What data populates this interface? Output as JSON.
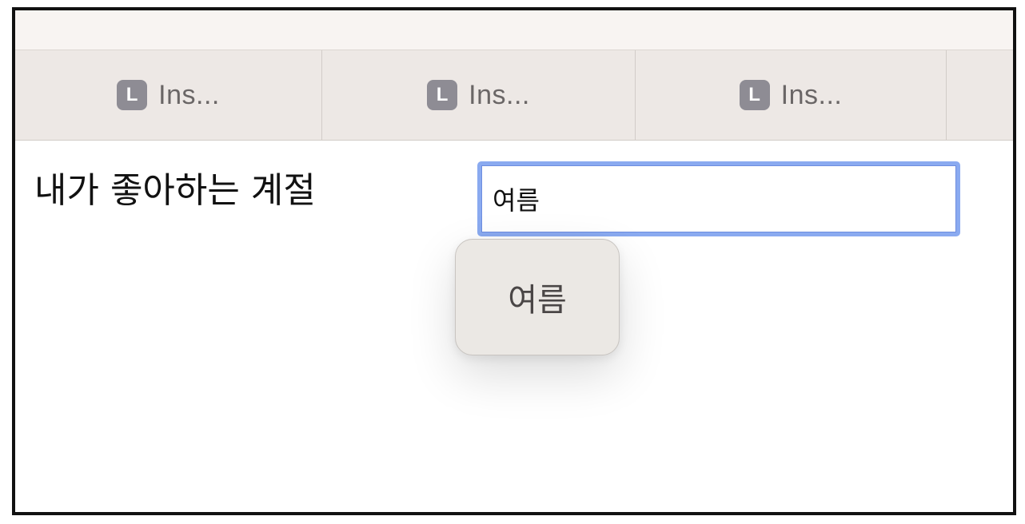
{
  "tabs": [
    {
      "favicon_letter": "L",
      "title": "Ins..."
    },
    {
      "favicon_letter": "L",
      "title": "Ins..."
    },
    {
      "favicon_letter": "L",
      "title": "Ins..."
    }
  ],
  "form": {
    "label": "내가 좋아하는 계절",
    "input_value": "여름"
  },
  "autocomplete": {
    "suggestion": "여름"
  },
  "colors": {
    "focus_ring": "#8aaaf0",
    "favicon": "#8e8c94",
    "tabbar": "#ede8e5",
    "popup": "#ebe8e4"
  }
}
